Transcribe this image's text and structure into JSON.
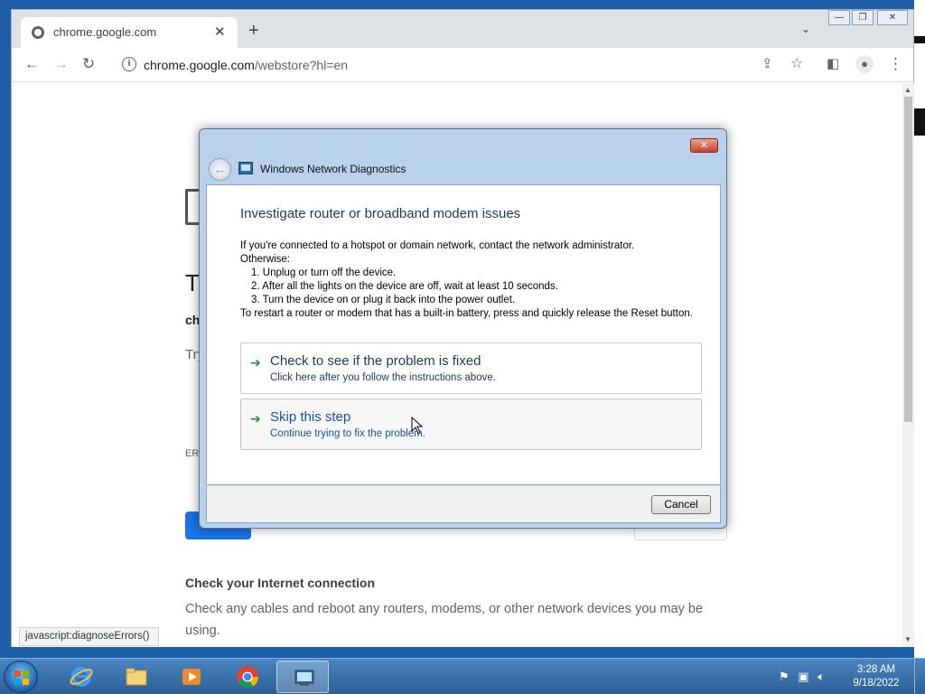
{
  "browser": {
    "tab_title": "chrome.google.com",
    "tab_close": "✕",
    "new_tab": "+",
    "url_host": "chrome.google.com",
    "url_path": "/webstore?hl=en",
    "status_bar": "javascript:diagnoseErrors()"
  },
  "error_page": {
    "heading": "Th",
    "subheading": "ch",
    "try_text": "Try",
    "error_code": "ERR",
    "check_heading": "Check your Internet connection",
    "check_text": "Check any cables and reboot any routers, modems, or other network devices you may be using."
  },
  "dialog": {
    "title": "Windows Network Diagnostics",
    "close": "✕",
    "heading": "Investigate router or broadband modem issues",
    "intro": "If you're connected to a hotspot or domain network, contact the network administrator.",
    "otherwise": "Otherwise:",
    "steps": [
      "1.  Unplug or turn off the device.",
      "2.  After all the lights on the device are off, wait at least 10 seconds.",
      "3.  Turn the device on or plug it back into the power outlet."
    ],
    "outro": "To restart a router or modem that has a built-in battery, press and quickly release the Reset button.",
    "options": [
      {
        "title": "Check to see if the problem is fixed",
        "desc": "Click here after you follow the instructions above."
      },
      {
        "title": "Skip this step",
        "desc": "Continue trying to fix the problem."
      }
    ],
    "cancel": "Cancel"
  },
  "taskbar": {
    "time": "3:28 AM",
    "date": "9/18/2022",
    "apps": [
      "internet-explorer",
      "file-explorer",
      "media-player",
      "chrome",
      "network-diagnostics"
    ]
  },
  "colors": {
    "dialog_heading": "#1e395b",
    "link_hover": "#1a52a3",
    "chrome_blue": "#1a73e8"
  }
}
